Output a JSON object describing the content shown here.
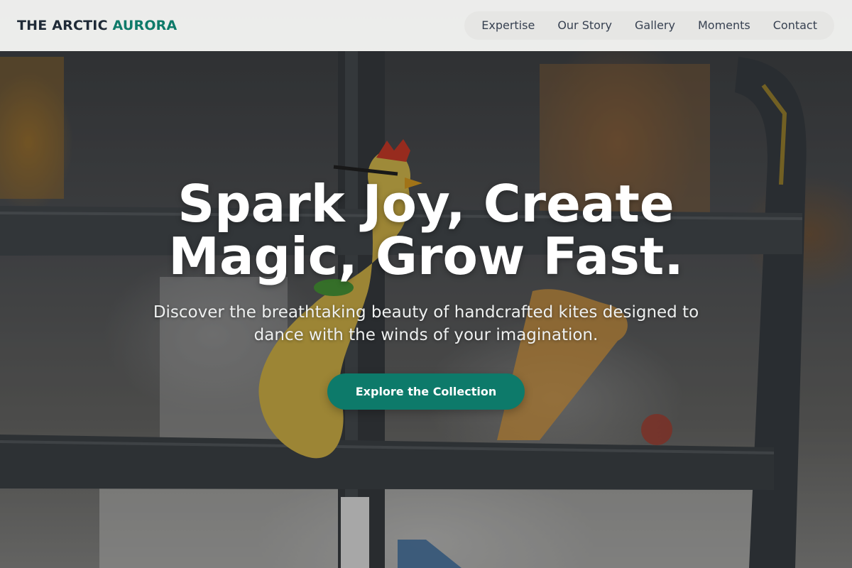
{
  "brand": {
    "name_part1": "THE ARCTIC",
    "name_part2": "AURORA",
    "accent_color": "#0e7a69"
  },
  "nav": {
    "items": [
      {
        "label": "Expertise"
      },
      {
        "label": "Our Story"
      },
      {
        "label": "Gallery"
      },
      {
        "label": "Moments"
      },
      {
        "label": "Contact"
      }
    ]
  },
  "hero": {
    "title": "Spark Joy, Create Magic, Grow Fast.",
    "subtitle": "Discover the breathtaking beauty of handcrafted kites designed to dance with the winds of your imagination.",
    "cta_label": "Explore the Collection",
    "cta_color": "#0d7a6a",
    "background_image_icon": "hero-photo-rubber-chicken-on-fence"
  }
}
